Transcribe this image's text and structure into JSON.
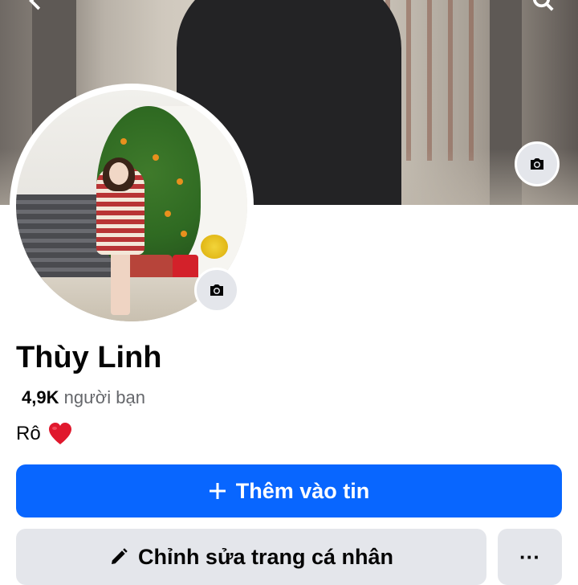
{
  "profile": {
    "name": "Thùy Linh",
    "friends_count": "4,9K",
    "friends_label": "người bạn",
    "bio_text": "Rô"
  },
  "actions": {
    "add_story_label": "Thêm vào tin",
    "edit_profile_label": "Chỉnh sửa trang cá nhân",
    "more_label": "···"
  },
  "icons": {
    "cover_camera": "camera-icon",
    "avatar_camera": "camera-icon",
    "add": "plus-icon",
    "edit": "pencil-icon",
    "more": "more-dots-icon",
    "heart": "red-heart-icon",
    "back": "back-arrow-icon",
    "search": "search-icon"
  },
  "colors": {
    "primary_button": "#0866ff",
    "secondary_button": "#e4e6eb",
    "text_primary": "#050505",
    "text_secondary": "#65676b"
  }
}
